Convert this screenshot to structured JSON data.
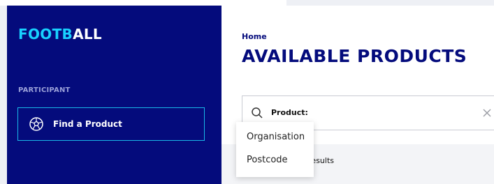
{
  "sidebar": {
    "logo_part1": "FOOTB",
    "logo_part2": "ALL",
    "section_label": "PARTICIPANT",
    "nav_item_label": "Find a Product",
    "nav_item_icon": "football-icon"
  },
  "main": {
    "breadcrumb": "Home",
    "title": "AVAILABLE PRODUCTS",
    "search": {
      "prefix": "Product:",
      "icon": "search-icon",
      "clear_icon": "close-icon"
    },
    "results_text": "esults"
  },
  "dropdown": {
    "options": [
      "Organisation",
      "Postcode"
    ]
  },
  "colors": {
    "sidebar_bg": "#040b7c",
    "logo_accent": "#18d1ff",
    "nav_border": "#19b8e8",
    "title": "#040b7c"
  }
}
